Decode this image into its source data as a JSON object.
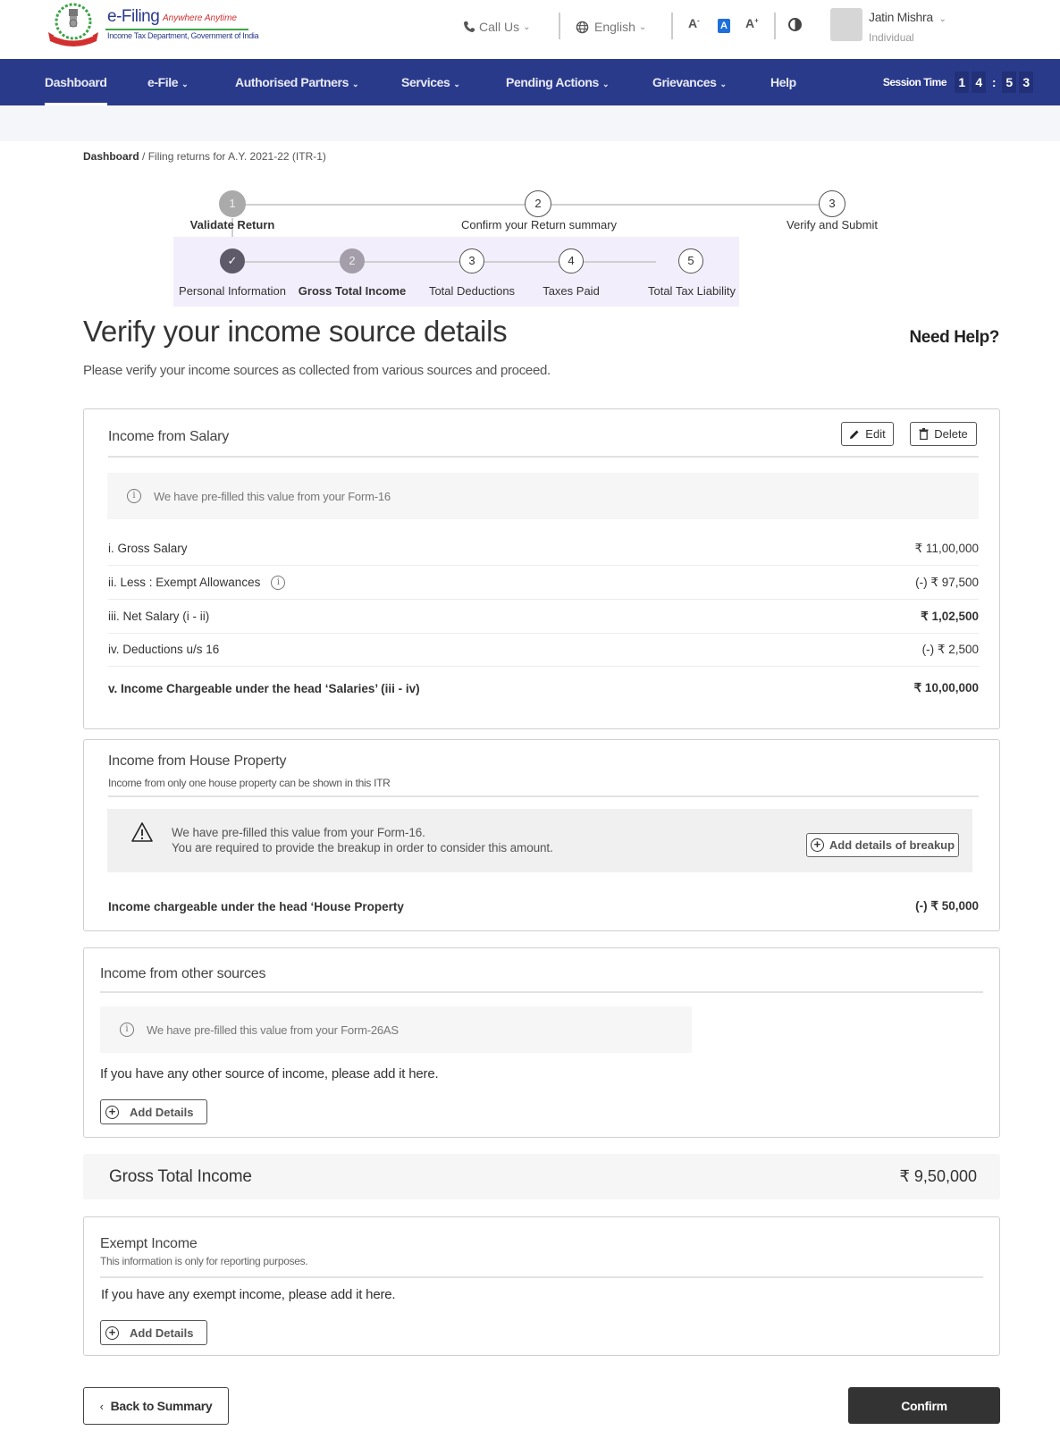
{
  "header": {
    "brand_title": "e-Filing",
    "brand_tagline": "Anywhere Anytime",
    "brand_subtitle": "Income Tax Department, Government of India",
    "call_us": "Call Us",
    "language": "English",
    "font_decrease": "A",
    "font_default": "A",
    "font_increase": "A",
    "user_name": "Jatin Mishra",
    "user_role": "Individual"
  },
  "nav": {
    "items": [
      {
        "label": "Dashboard",
        "has_dropdown": false,
        "active": true
      },
      {
        "label": "e-File",
        "has_dropdown": true
      },
      {
        "label": "Authorised Partners",
        "has_dropdown": true
      },
      {
        "label": "Services",
        "has_dropdown": true
      },
      {
        "label": "Pending Actions",
        "has_dropdown": true
      },
      {
        "label": "Grievances",
        "has_dropdown": true
      },
      {
        "label": "Help",
        "has_dropdown": false
      }
    ],
    "session_label": "Session Time",
    "session_digits": [
      "1",
      "4",
      ":",
      "5",
      "3"
    ]
  },
  "breadcrumb": {
    "root": "Dashboard",
    "separator": " / ",
    "current": "Filing returns for A.Y. 2021-22 (ITR-1)"
  },
  "stepper": {
    "main_steps": [
      {
        "number": "1",
        "label": "Validate Return",
        "state": "current"
      },
      {
        "number": "2",
        "label": "Confirm your Return summary",
        "state": "pending"
      },
      {
        "number": "3",
        "label": "Verify and Submit",
        "state": "pending"
      }
    ],
    "sub_steps": [
      {
        "number": "✓",
        "label": "Personal Information",
        "state": "complete"
      },
      {
        "number": "2",
        "label": "Gross Total Income",
        "state": "current"
      },
      {
        "number": "3",
        "label": "Total Deductions",
        "state": "pending"
      },
      {
        "number": "4",
        "label": "Taxes Paid",
        "state": "pending"
      },
      {
        "number": "5",
        "label": "Total Tax Liability",
        "state": "pending"
      }
    ]
  },
  "page": {
    "title": "Verify your income source details",
    "need_help": "Need Help?",
    "description": "Please verify your income sources as collected from various sources and proceed."
  },
  "salary": {
    "title": "Income from Salary",
    "edit_label": "Edit",
    "delete_label": "Delete",
    "info": "We have pre-filled this value from your Form-16",
    "rows": [
      {
        "label": "i. Gross Salary",
        "value": "₹ 11,00,000"
      },
      {
        "label": "ii. Less : Exempt Allowances",
        "value": "(-) ₹ 97,500"
      },
      {
        "label": "iii. Net Salary (i - ii)",
        "value": "₹ 1,02,500"
      },
      {
        "label": "iv. Deductions u/s 16",
        "value": "(-) ₹ 2,500"
      },
      {
        "label": "v. Income Chargeable under the head ‘Salaries’  (iii - iv)",
        "value": "₹ 10,00,000"
      }
    ]
  },
  "house_property": {
    "title": "Income from House Property",
    "subtitle": "Income from only one house property can be shown in this ITR",
    "warning_line1": "We have pre-filled this value from your Form-16.",
    "warning_line2": "You are required to provide the breakup in order to consider this amount.",
    "add_breakup_label": "Add details of breakup",
    "chargeable_label": "Income chargeable under the head ‘House Property",
    "chargeable_value": "(-) ₹ 50,000"
  },
  "other_sources": {
    "title": "Income from other sources",
    "info": "We have pre-filled this value from your Form-26AS",
    "prompt": "If you have any other source of income, please add it here.",
    "add_label": "Add Details"
  },
  "gross_total_income": {
    "label": "Gross Total Income",
    "value": "₹ 9,50,000"
  },
  "exempt_income": {
    "title": "Exempt Income",
    "subtitle": "This information is only for reporting purposes.",
    "prompt": "If you have any exempt income, please add it here.",
    "add_label": "Add Details"
  },
  "footer": {
    "back_label": "Back to Summary",
    "confirm_label": "Confirm"
  }
}
